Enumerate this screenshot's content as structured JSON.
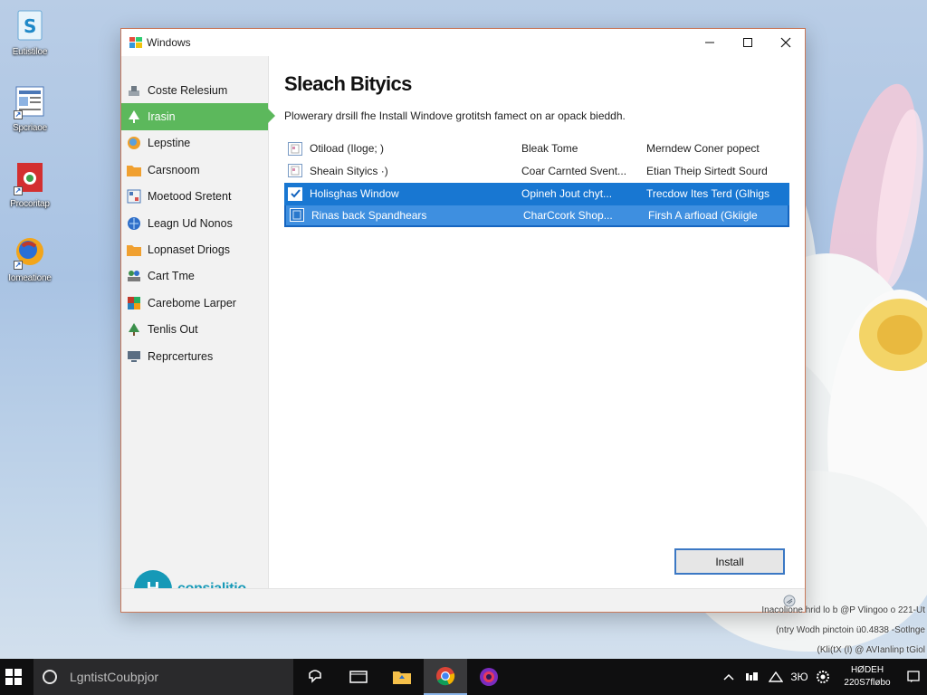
{
  "desktop": {
    "icons": [
      {
        "label": "Eutistiloe",
        "icon": "document-s-icon"
      },
      {
        "label": "Spcriaoe",
        "icon": "document-page-icon"
      },
      {
        "label": "Procoritap",
        "icon": "red-app-icon"
      },
      {
        "label": "Iomeatione",
        "icon": "browser-globe-icon"
      }
    ],
    "watermark": [
      "Inacolione hrid lo b @P Vlingoo o 221-Ut",
      "(ntry Wodh pinctoin ü0.4838 -Sotlnge",
      "(Kli(tX (l) @ AVIanlinp tGiol"
    ]
  },
  "window": {
    "title": "Windows",
    "sidebar": {
      "items": [
        {
          "label": "Coste Relesium",
          "icon": "tools-icon"
        },
        {
          "label": "Irasin",
          "icon": "tree-icon",
          "active": true
        },
        {
          "label": "Lepstine",
          "icon": "globe-icon"
        },
        {
          "label": "Carsnoom",
          "icon": "folder-icon"
        },
        {
          "label": "Moetood Sretent",
          "icon": "network-icon"
        },
        {
          "label": "Leagn Ud Nonos",
          "icon": "globe-blue-icon"
        },
        {
          "label": "Lopnaset Driogs",
          "icon": "folder-icon"
        },
        {
          "label": "Cart Tme",
          "icon": "people-icon"
        },
        {
          "label": "Carebome Larper",
          "icon": "package-icon"
        },
        {
          "label": "Tenlis Out",
          "icon": "tree-icon"
        },
        {
          "label": "Reprcertures",
          "icon": "monitor-icon"
        }
      ],
      "brand": {
        "logo_text": "H",
        "name": "consialitio"
      }
    },
    "main": {
      "heading": "Sleach Bityics",
      "description": "Plowerary drsill fhe Install Windove grotitsh famect on ar opack bieddh.",
      "rows": [
        {
          "checked": false,
          "col1": "Otiload (Iloge; )",
          "col2": "Bleak Tome",
          "col3": "Merndew Coner popect",
          "state": "normal"
        },
        {
          "checked": false,
          "col1": "Sheain Sityics ·)",
          "col2": "Coar Carnted Svent...",
          "col3": "Etian Theip Sirtedt Sourd",
          "state": "normal"
        },
        {
          "checked": true,
          "col1": "Holisghas Window",
          "col2": "Opineh Jout chyt...",
          "col3": "Trecdow Ites Terd (Glhigs",
          "state": "selected"
        },
        {
          "checked": false,
          "col1": "Rinas back Spandhears",
          "col2": "CharCcork Shop...",
          "col3": "Firsh A arfioad (Gkiigle",
          "state": "selected-light"
        }
      ],
      "install_label": "Install"
    }
  },
  "taskbar": {
    "search_placeholder": "LgntistCoubpjor",
    "apps": [
      "task-view-icon",
      "file-explorer-icon",
      "folder-icon",
      "chrome-icon",
      "media-icon"
    ],
    "tray_text": "ЗЮ",
    "clock": {
      "time": "HØDEH",
      "date": "220S7fløbo"
    }
  }
}
